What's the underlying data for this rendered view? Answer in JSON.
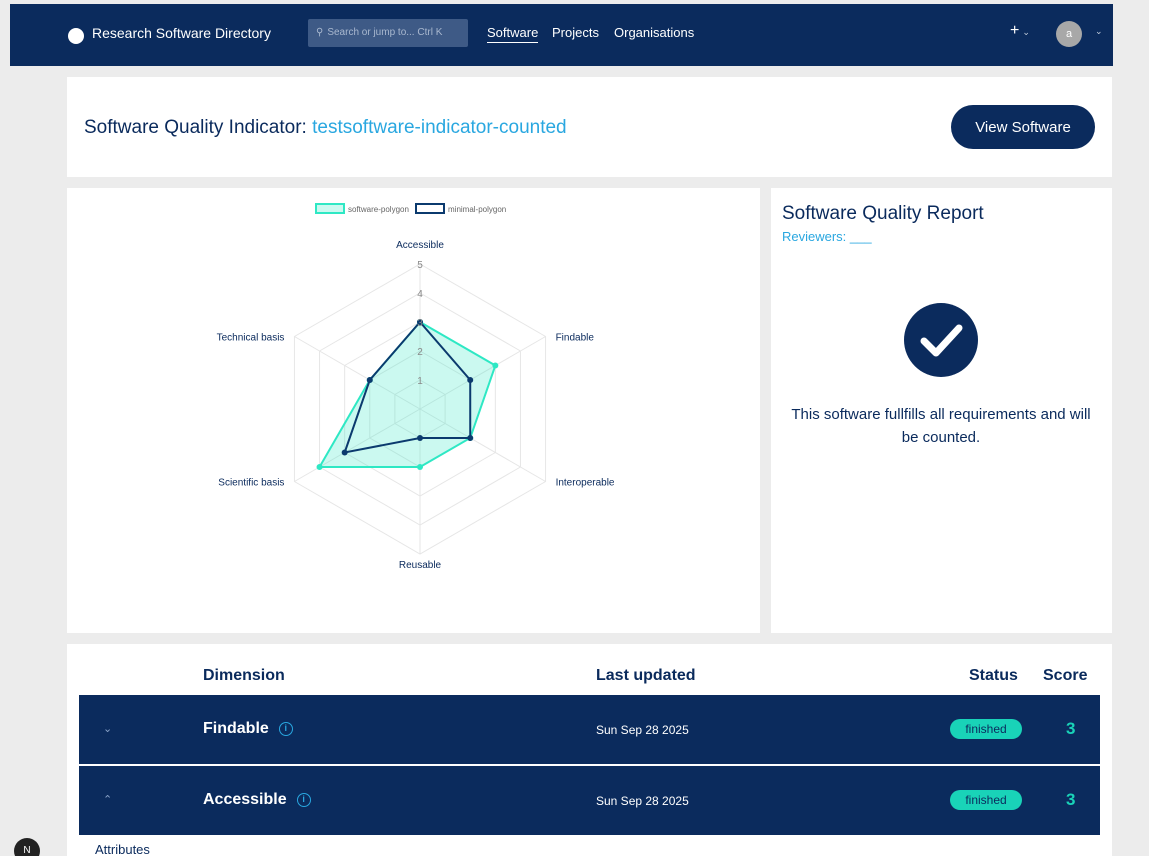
{
  "topbar": {
    "brand": "Research Software Directory",
    "search_placeholder": "Search or jump to...",
    "search_shortcut": "Ctrl K",
    "nav": [
      "Software",
      "Projects",
      "Organisations"
    ],
    "plus": "+",
    "avatar": "a"
  },
  "header": {
    "title_prefix": "Software Quality Indicator:",
    "software_name": "testsoftware-indicator-counted",
    "view_button": "View Software"
  },
  "chart_data": {
    "type": "radar",
    "axes": [
      "Accessible",
      "Findable",
      "Interoperable",
      "Reusable",
      "Scientific basis",
      "Technical basis"
    ],
    "rlim": [
      0,
      5
    ],
    "ticks": [
      "1",
      "2",
      "3",
      "4",
      "5"
    ],
    "series": [
      {
        "name": "software-polygon",
        "values": [
          3,
          3,
          2,
          2,
          4,
          2
        ],
        "color": "#2ee8c4"
      },
      {
        "name": "minimal-polygon",
        "values": [
          3,
          2,
          2,
          1,
          3,
          2
        ],
        "color": "#0b3a6e"
      }
    ],
    "legend": "top"
  },
  "report": {
    "title": "Software Quality Report",
    "reviewers": "Reviewers: ___",
    "message": "This software fullfills all requirements and will be counted."
  },
  "table": {
    "headers": {
      "dimension": "Dimension",
      "last_updated": "Last updated",
      "status": "Status",
      "score": "Score"
    },
    "rows": [
      {
        "chevron": "⌄",
        "dimension": "Findable",
        "info": "i",
        "date": "Sun Sep 28 2025",
        "status": "finished",
        "score": "3"
      },
      {
        "chevron": "⌃",
        "dimension": "Accessible",
        "info": "i",
        "date": "Sun Sep 28 2025",
        "status": "finished",
        "score": "3"
      }
    ],
    "attributes_label": "Attributes"
  },
  "dev_badge": "N",
  "colors": {
    "navy": "#0b2b5d",
    "teal": "#19d3b8",
    "link": "#29a7e0"
  }
}
